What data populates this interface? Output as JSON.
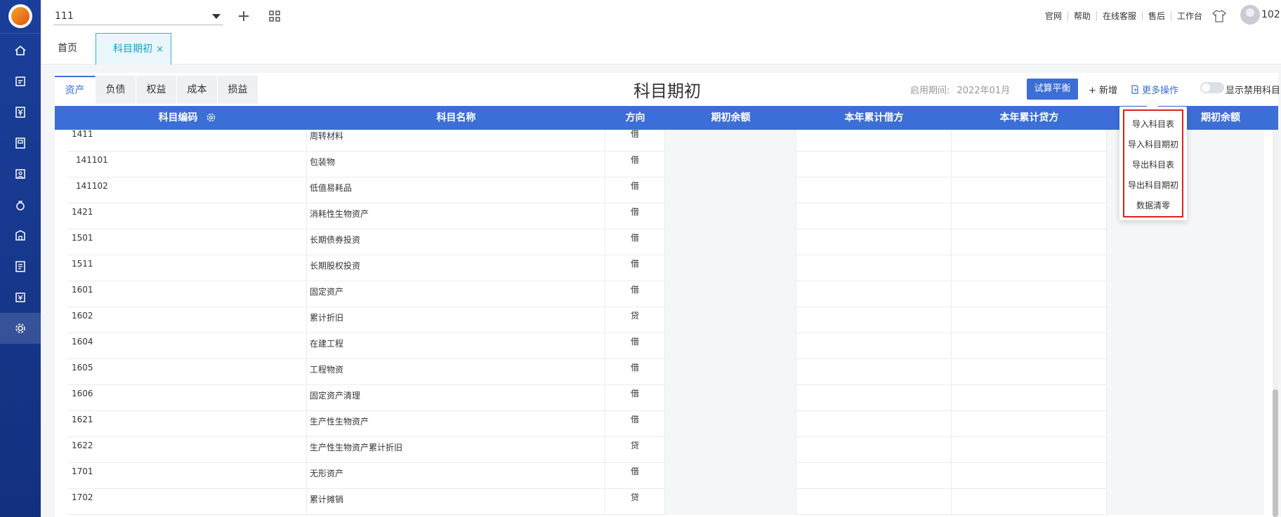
{
  "topbar": {
    "account_name": "111",
    "links": [
      "官网",
      "帮助",
      "在线客服",
      "售后",
      "工作台"
    ],
    "username": "102"
  },
  "tabs": {
    "home": "首页",
    "current": "科目期初",
    "close": "×"
  },
  "categories": [
    "资产",
    "负债",
    "权益",
    "成本",
    "损益"
  ],
  "page": {
    "title": "科目期初",
    "period_label": "启用期间:",
    "period_value": "2022年01月",
    "trial_balance": "试算平衡",
    "add": "+ 新增",
    "more": "更多操作",
    "show_disabled": "显示禁用科目"
  },
  "table": {
    "headers": [
      "科目编码",
      "科目名称",
      "方向",
      "期初余额",
      "本年累计借方",
      "本年累计贷方",
      "期初余额"
    ],
    "rows": [
      {
        "code": "1411",
        "name": "周转材料",
        "dir": "借"
      },
      {
        "code": "141101",
        "name": "包装物",
        "dir": "借"
      },
      {
        "code": "141102",
        "name": "低值易耗品",
        "dir": "借"
      },
      {
        "code": "1421",
        "name": "消耗性生物资产",
        "dir": "借"
      },
      {
        "code": "1501",
        "name": "长期债券投资",
        "dir": "借"
      },
      {
        "code": "1511",
        "name": "长期股权投资",
        "dir": "借"
      },
      {
        "code": "1601",
        "name": "固定资产",
        "dir": "借"
      },
      {
        "code": "1602",
        "name": "累计折旧",
        "dir": "贷"
      },
      {
        "code": "1604",
        "name": "在建工程",
        "dir": "借"
      },
      {
        "code": "1605",
        "name": "工程物资",
        "dir": "借"
      },
      {
        "code": "1606",
        "name": "固定资产清理",
        "dir": "借"
      },
      {
        "code": "1621",
        "name": "生产性生物资产",
        "dir": "借"
      },
      {
        "code": "1622",
        "name": "生产性生物资产累计折旧",
        "dir": "贷"
      },
      {
        "code": "1701",
        "name": "无形资产",
        "dir": "借"
      },
      {
        "code": "1702",
        "name": "累计摊销",
        "dir": "贷"
      }
    ]
  },
  "more_menu": [
    "导入科目表",
    "导入科目期初",
    "导出科目表",
    "导出科目期初",
    "数据清零"
  ],
  "colors": {
    "sidebar": "#1a3f9a",
    "accent": "#3b6ed6",
    "tab_active": "#29b6d6",
    "highlight_box": "#e02020"
  }
}
